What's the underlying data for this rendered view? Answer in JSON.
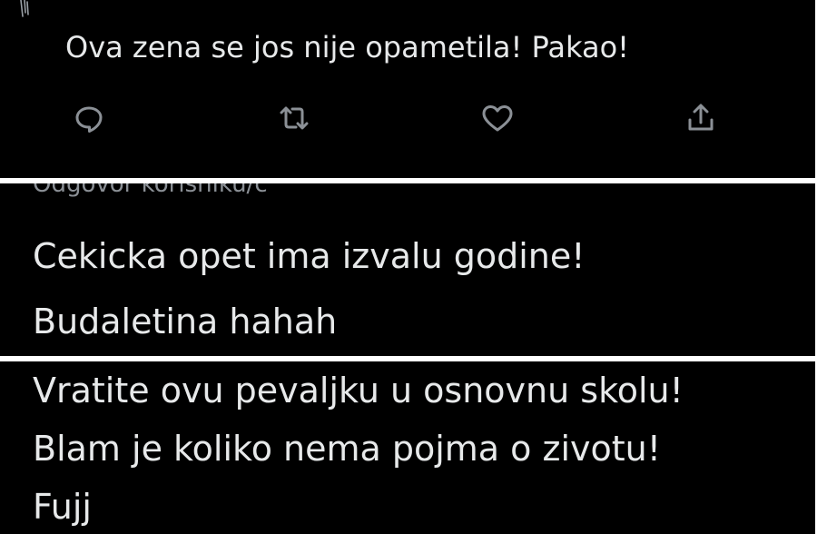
{
  "tweet1": {
    "text": "Ova zena se jos nije opametila! Pakao!",
    "actions": {
      "reply_icon": "reply-bubble-icon",
      "retweet_icon": "retweet-arrows-icon",
      "like_icon": "heart-icon",
      "share_icon": "share-upload-icon"
    }
  },
  "tweet2": {
    "reply_context": "Odgovor korisniku/c",
    "lines": [
      "Cekicka opet ima izvalu godine!",
      "Budaletina hahah"
    ]
  },
  "tweet3": {
    "lines": [
      "Vratite ovu pevaljku u osnovnu skolu!",
      "Blam je koliko nema pojma o zivotu!",
      "Fujj"
    ]
  },
  "colors": {
    "background": "#000000",
    "text": "#e7e9ea",
    "icon": "#8b9096",
    "separator": "#ffffff"
  }
}
